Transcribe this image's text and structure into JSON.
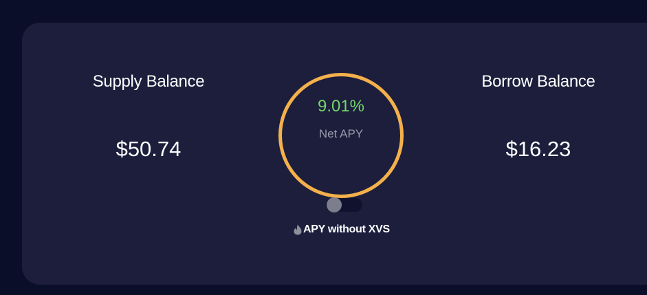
{
  "supply": {
    "label": "Supply Balance",
    "value": "$50.74"
  },
  "borrow": {
    "label": "Borrow Balance",
    "value": "$16.23"
  },
  "apy": {
    "value": "9.01%",
    "label": "Net APY"
  },
  "xvs_toggle": {
    "label": "APY without XVS",
    "enabled": false,
    "icon": "flame-icon"
  },
  "colors": {
    "page_background": "#0b0e28",
    "card_background": "#1c1e3c",
    "ring": "#f4b14b",
    "apy_value": "#76d66b",
    "muted_text": "#9a9bab"
  }
}
